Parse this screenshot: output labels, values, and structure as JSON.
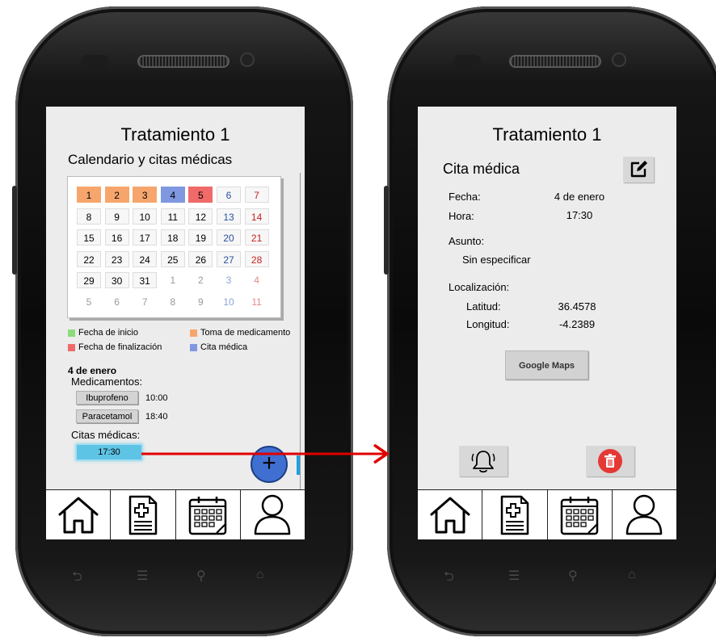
{
  "colors": {
    "start": "#8cdc7c",
    "medication": "#f6a66c",
    "end": "#f06a6a",
    "appointment": "#7f98e0",
    "arrow": "#e00000",
    "fab": "#3f6fd1",
    "delete": "#e53935"
  },
  "calendar_screen": {
    "title": "Tratamiento 1",
    "subtitle": "Calendario y citas médicas",
    "calendar": {
      "weeks": [
        [
          {
            "t": "1",
            "k": "med"
          },
          {
            "t": "2",
            "k": "med"
          },
          {
            "t": "3",
            "k": "med"
          },
          {
            "t": "4",
            "k": "appt"
          },
          {
            "t": "5",
            "k": "end"
          },
          {
            "t": "6",
            "k": "sat"
          },
          {
            "t": "7",
            "k": "sun"
          }
        ],
        [
          {
            "t": "8",
            "k": "day"
          },
          {
            "t": "9",
            "k": "day"
          },
          {
            "t": "10",
            "k": "day"
          },
          {
            "t": "11",
            "k": "day"
          },
          {
            "t": "12",
            "k": "day"
          },
          {
            "t": "13",
            "k": "sat"
          },
          {
            "t": "14",
            "k": "sun"
          }
        ],
        [
          {
            "t": "15",
            "k": "day"
          },
          {
            "t": "16",
            "k": "day"
          },
          {
            "t": "17",
            "k": "day"
          },
          {
            "t": "18",
            "k": "day"
          },
          {
            "t": "19",
            "k": "day"
          },
          {
            "t": "20",
            "k": "sat"
          },
          {
            "t": "21",
            "k": "sun"
          }
        ],
        [
          {
            "t": "22",
            "k": "day"
          },
          {
            "t": "23",
            "k": "day"
          },
          {
            "t": "24",
            "k": "day"
          },
          {
            "t": "25",
            "k": "day"
          },
          {
            "t": "26",
            "k": "day"
          },
          {
            "t": "27",
            "k": "sat"
          },
          {
            "t": "28",
            "k": "sun"
          }
        ],
        [
          {
            "t": "29",
            "k": "day"
          },
          {
            "t": "30",
            "k": "day"
          },
          {
            "t": "31",
            "k": "day"
          },
          {
            "t": "1",
            "k": "muted"
          },
          {
            "t": "2",
            "k": "muted"
          },
          {
            "t": "3",
            "k": "sat muted"
          },
          {
            "t": "4",
            "k": "sun muted"
          }
        ],
        [
          {
            "t": "5",
            "k": "muted"
          },
          {
            "t": "6",
            "k": "muted"
          },
          {
            "t": "7",
            "k": "muted"
          },
          {
            "t": "8",
            "k": "muted"
          },
          {
            "t": "9",
            "k": "muted"
          },
          {
            "t": "10",
            "k": "sat muted"
          },
          {
            "t": "11",
            "k": "sun muted"
          }
        ]
      ]
    },
    "legend": {
      "start": "Fecha de inicio",
      "medication": "Toma de medicamento",
      "end": "Fecha de finalización",
      "appointment": "Cita médica"
    },
    "day_title": "4 de enero",
    "medications_label": "Medicamentos:",
    "medications": [
      {
        "name": "Ibuprofeno",
        "time": "10:00"
      },
      {
        "name": "Paracetamol",
        "time": "18:40"
      }
    ],
    "appointments_label": "Citas médicas:",
    "appointment_time": "17:30",
    "fab_label": "+"
  },
  "detail_screen": {
    "title": "Tratamiento 1",
    "subtitle": "Cita médica",
    "fecha_label": "Fecha:",
    "fecha_value": "4 de enero",
    "hora_label": "Hora:",
    "hora_value": "17:30",
    "asunto_label": "Asunto:",
    "asunto_value": "Sin especificar",
    "localizacion_label": "Localización:",
    "latitud_label": "Latitud:",
    "latitud_value": "36.4578",
    "longitud_label": "Longitud:",
    "longitud_value": "-4.2389",
    "maps_button": "Google Maps"
  },
  "nav_icons": [
    "home-icon",
    "prescription-icon",
    "calendar-icon",
    "profile-icon"
  ]
}
